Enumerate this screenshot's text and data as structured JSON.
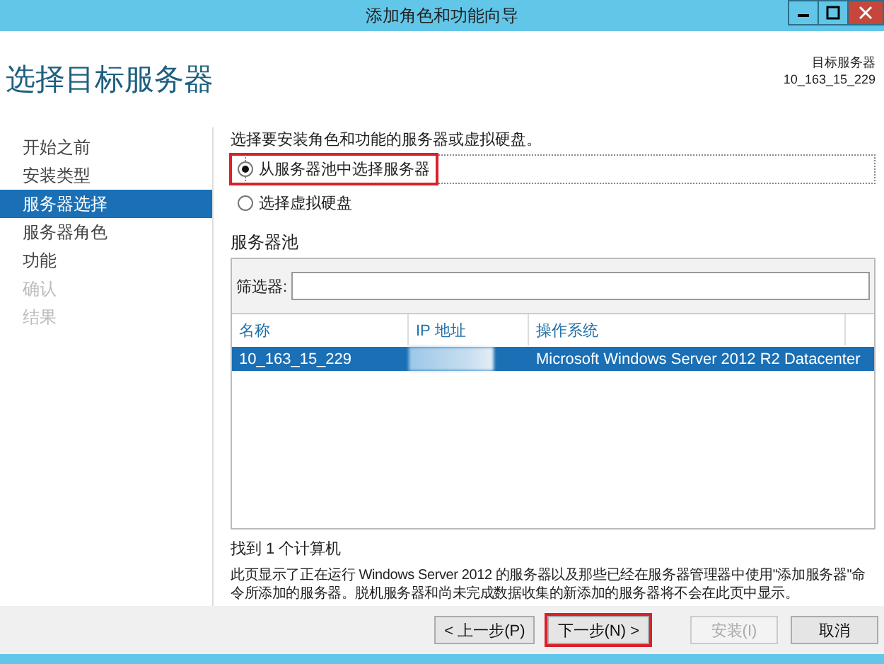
{
  "window": {
    "title": "添加角色和功能向导"
  },
  "header": {
    "title": "选择目标服务器",
    "target_label": "目标服务器",
    "target_value": "10_163_15_229"
  },
  "sidebar": {
    "items": [
      {
        "label": "开始之前",
        "selected": false,
        "disabled": false
      },
      {
        "label": "安装类型",
        "selected": false,
        "disabled": false
      },
      {
        "label": "服务器选择",
        "selected": true,
        "disabled": false
      },
      {
        "label": "服务器角色",
        "selected": false,
        "disabled": false
      },
      {
        "label": "功能",
        "selected": false,
        "disabled": false
      },
      {
        "label": "确认",
        "selected": false,
        "disabled": true
      },
      {
        "label": "结果",
        "selected": false,
        "disabled": true
      }
    ]
  },
  "intro": "选择要安装角色和功能的服务器或虚拟硬盘。",
  "options": [
    {
      "label": "从服务器池中选择服务器",
      "selected": true,
      "highlighted": true
    },
    {
      "label": "选择虚拟硬盘",
      "selected": false,
      "highlighted": false
    }
  ],
  "pool": {
    "title": "服务器池",
    "filter_label": "筛选器:",
    "columns": [
      "名称",
      "IP 地址",
      "操作系统"
    ],
    "rows": [
      {
        "name": "10_163_15_229",
        "ip_redacted": true,
        "os": "Microsoft Windows Server 2012 R2 Datacenter",
        "selected": true
      }
    ]
  },
  "found": "找到 1 个计算机",
  "description": "此页显示了正在运行 Windows Server 2012 的服务器以及那些已经在服务器管理器中使用\"添加服务器\"命令所添加的服务器。脱机服务器和尚未完成数据收集的新添加的服务器将不会在此页中显示。",
  "buttons": [
    {
      "label": "< 上一步(P)",
      "disabled": false,
      "highlighted": false
    },
    {
      "label": "下一步(N) >",
      "disabled": false,
      "highlighted": true
    },
    {
      "label": "安装(I)",
      "disabled": true,
      "highlighted": false
    },
    {
      "label": "取消",
      "disabled": false,
      "highlighted": false
    }
  ]
}
